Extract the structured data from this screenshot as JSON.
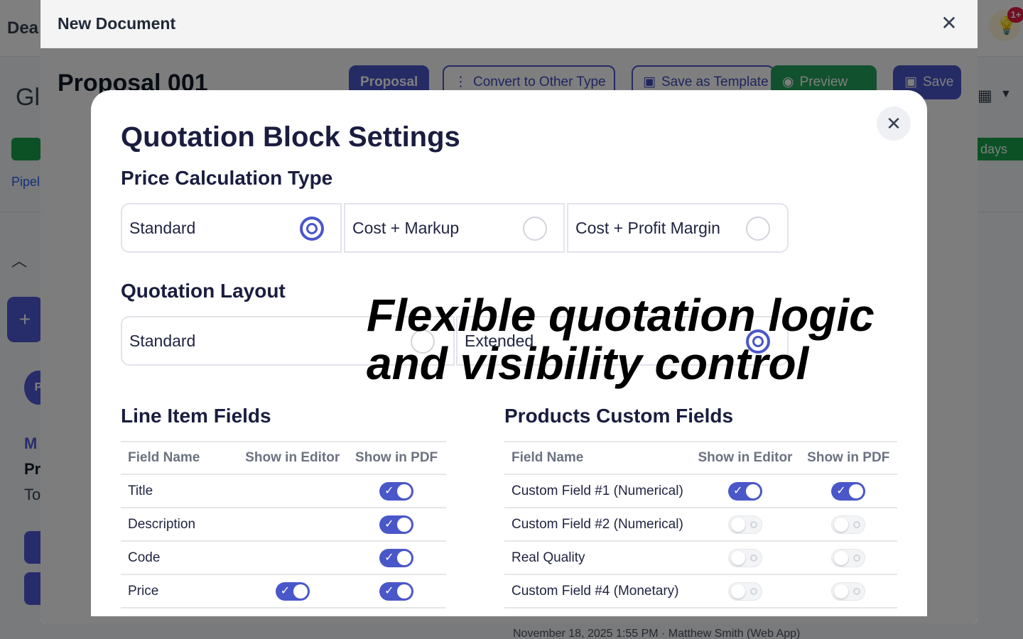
{
  "app": {
    "header_title_partial": "Dea",
    "notification_badge": "1+",
    "gl_text": "Gl",
    "days_badge": "days",
    "pipeline_partial": "Pipel",
    "avatar_letter": "P",
    "m_label": "M",
    "pr_label": "Pr",
    "to_label": "To",
    "footer_meta": "November 18, 2025 1:55 PM · Matthew Smith (Web App)"
  },
  "new_document": {
    "title": "New Document",
    "document_title": "Proposal 001",
    "buttons": {
      "proposal": "Proposal",
      "convert": "Convert to Other Type",
      "save_template": "Save as Template",
      "preview": "Preview",
      "save": "Save"
    }
  },
  "quotation_settings": {
    "title": "Quotation Block Settings",
    "price_calc": {
      "heading": "Price Calculation Type",
      "options": [
        "Standard",
        "Cost + Markup",
        "Cost + Profit Margin"
      ],
      "selected": "Standard"
    },
    "layout": {
      "heading": "Quotation Layout",
      "options": [
        "Standard",
        "Extended"
      ],
      "selected": "Extended"
    },
    "line_items": {
      "heading": "Line Item Fields",
      "columns": [
        "Field Name",
        "Show in Editor",
        "Show in PDF"
      ],
      "rows": [
        {
          "name": "Title",
          "editor": null,
          "pdf": true
        },
        {
          "name": "Description",
          "editor": null,
          "pdf": true
        },
        {
          "name": "Code",
          "editor": null,
          "pdf": true
        },
        {
          "name": "Price",
          "editor": true,
          "pdf": true
        }
      ]
    },
    "products_custom": {
      "heading": "Products Custom Fields",
      "columns": [
        "Field Name",
        "Show in Editor",
        "Show in PDF"
      ],
      "rows": [
        {
          "name": "Custom Field #1 (Numerical)",
          "editor": true,
          "pdf": true
        },
        {
          "name": "Custom Field #2 (Numerical)",
          "editor": false,
          "pdf": false
        },
        {
          "name": "Real Quality",
          "editor": false,
          "pdf": false
        },
        {
          "name": "Custom Field #4 (Monetary)",
          "editor": false,
          "pdf": false
        }
      ]
    }
  },
  "caption": {
    "line1": "Flexible quotation logic",
    "line2": "and visibility control"
  },
  "colors": {
    "accent": "#4a57c9",
    "preview_green": "#22a35a",
    "heading": "#1a1d3f"
  }
}
